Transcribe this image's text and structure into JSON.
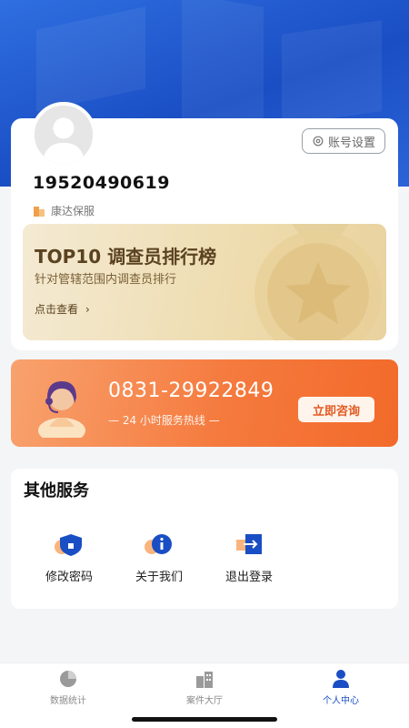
{
  "profile": {
    "phone": "19520490619",
    "company": "康达保服",
    "settings_label": "账号设置"
  },
  "rank_banner": {
    "title": "TOP10 调查员排行榜",
    "subtitle": "针对管辖范围内调查员排行",
    "link_label": "点击查看"
  },
  "hotline": {
    "number": "0831-29922849",
    "note": "— 24 小时服务热线 —",
    "button_label": "立即咨询"
  },
  "services": {
    "title": "其他服务",
    "items": [
      {
        "label": "修改密码",
        "icon": "shield-lock-icon"
      },
      {
        "label": "关于我们",
        "icon": "info-icon"
      },
      {
        "label": "退出登录",
        "icon": "logout-icon"
      }
    ]
  },
  "tabbar": {
    "tabs": [
      {
        "label": "数据统计",
        "icon": "pie-chart-icon",
        "active": false
      },
      {
        "label": "案件大厅",
        "icon": "building-icon",
        "active": false
      },
      {
        "label": "个人中心",
        "icon": "person-icon",
        "active": true
      }
    ]
  },
  "colors": {
    "brand_blue": "#1a4ec4",
    "hotline_orange": "#f57a3e",
    "gold": "#e9d29e"
  }
}
